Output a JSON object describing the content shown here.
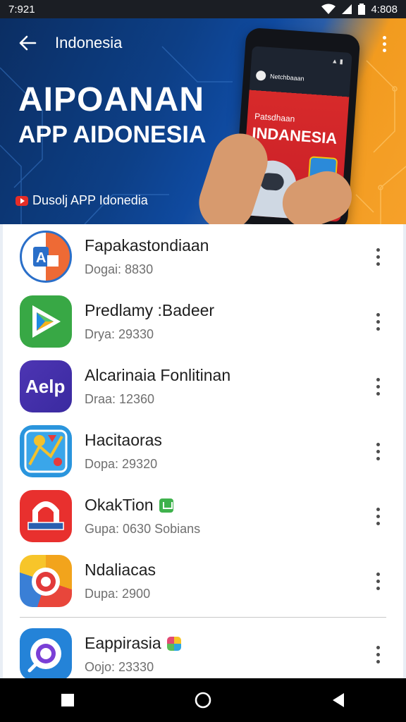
{
  "status_bar": {
    "time": "7:921",
    "battery_text": "4:808",
    "icons": [
      "wifi-icon",
      "signal-icon",
      "battery-icon"
    ]
  },
  "header": {
    "title": "Indonesia",
    "hero_title_line1": "AIPOANAN",
    "hero_title_line2": "APP AIDONESIA",
    "hero_subtitle": "Dusolj APP Idonedia",
    "phone_header_text": "Netchbaaan",
    "phone_small_text": "Patsdhaan",
    "phone_big_text": "INDANESIA"
  },
  "apps": [
    {
      "name": "Fapakastondiaan",
      "meta": "Dogai: 8830",
      "icon": "ap-logo-icon"
    },
    {
      "name": "Predlamy :Badeer",
      "meta": "Drya: 29330",
      "icon": "play-store-icon"
    },
    {
      "name": "Alcarinaia Fonlitinan",
      "meta": "Draa: 12360",
      "icon": "aelp-icon"
    },
    {
      "name": "Hacitaoras",
      "meta": "Dopa: 29320",
      "icon": "map-drawing-icon"
    },
    {
      "name": "OkakTion",
      "meta": "Gupa: 0630 Sobians",
      "icon": "shop-arch-icon",
      "badge": "green-badge-icon"
    },
    {
      "name": "Ndaliacas",
      "meta": "Dupa: 2900",
      "icon": "target-colorful-icon"
    },
    {
      "name": "Eappirasia",
      "meta": "Oojo: 23330",
      "icon": "search-circle-icon",
      "badge": "multicolor-badge-icon"
    }
  ],
  "colors": {
    "hero_blue": "#0d3f86",
    "hero_orange": "#f29b1f",
    "status_bar": "#1b1e24",
    "nav_bar": "#000000"
  }
}
